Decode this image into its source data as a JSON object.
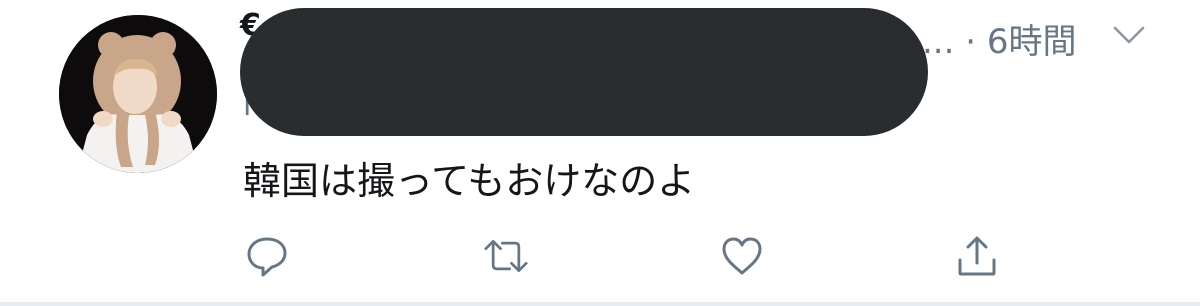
{
  "tweet": {
    "author_name_visible": "€",
    "handle_visible": "l",
    "author_ellipsis": "...",
    "separator": "·",
    "timestamp": "6時間",
    "text": "韓国は撮ってもおけなのよ"
  },
  "colors": {
    "text_primary": "#14171a",
    "text_secondary": "#657786",
    "icon": "#657786",
    "redaction": "#2a2d30"
  },
  "icons": {
    "reply": "speech-bubble-icon",
    "retweet": "retweet-arrows-icon",
    "like": "heart-icon",
    "share": "share-upload-icon",
    "menu": "chevron-down-icon"
  }
}
